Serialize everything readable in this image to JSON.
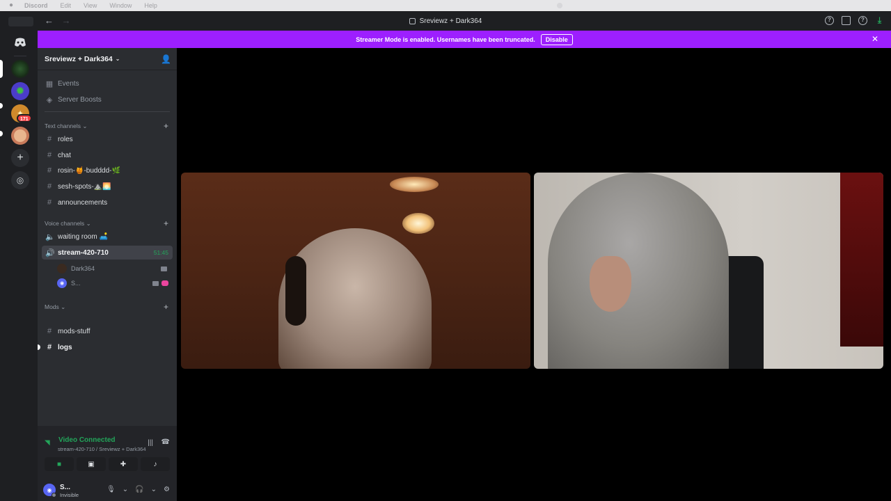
{
  "menubar": {
    "app_name": "Discord",
    "items": [
      "Edit",
      "View",
      "Window",
      "Help"
    ]
  },
  "titlebar": {
    "title": "Sreviewz + Dark364",
    "back": "←",
    "forward": "→"
  },
  "banner": {
    "message": "Streamer Mode is enabled. Usernames have been truncated.",
    "disable_label": "Disable",
    "close": "✕"
  },
  "rail": {
    "unread_badge": "171"
  },
  "guild": {
    "name": "Sreviewz + Dark364",
    "top_items": [
      {
        "label": "Events"
      },
      {
        "label": "Server Boosts"
      }
    ],
    "categories": {
      "text": "Text channels",
      "voice": "Voice channels",
      "mods": "Mods"
    },
    "text_channels": [
      "roles",
      "chat",
      "rosin-🍯-budddd-🌿",
      "sesh-spots-⛰️🌅",
      "announcements"
    ],
    "voice_channels": [
      {
        "name": "waiting room 🛋️"
      },
      {
        "name": "stream-420-710",
        "timer": "51:45"
      }
    ],
    "voice_users": [
      "Dark364",
      "S..."
    ],
    "mod_channels": [
      "mods-stuff",
      "logs"
    ]
  },
  "voice_panel": {
    "status": "Video Connected",
    "sub": "stream-420-710 / Sreviewz + Dark364"
  },
  "user": {
    "name": "S...",
    "status": "Invisible"
  },
  "colors": {
    "banner": "#9d1fff",
    "connected": "#23a55a",
    "sidebar": "#2b2d31",
    "rail": "#1e1f22"
  }
}
